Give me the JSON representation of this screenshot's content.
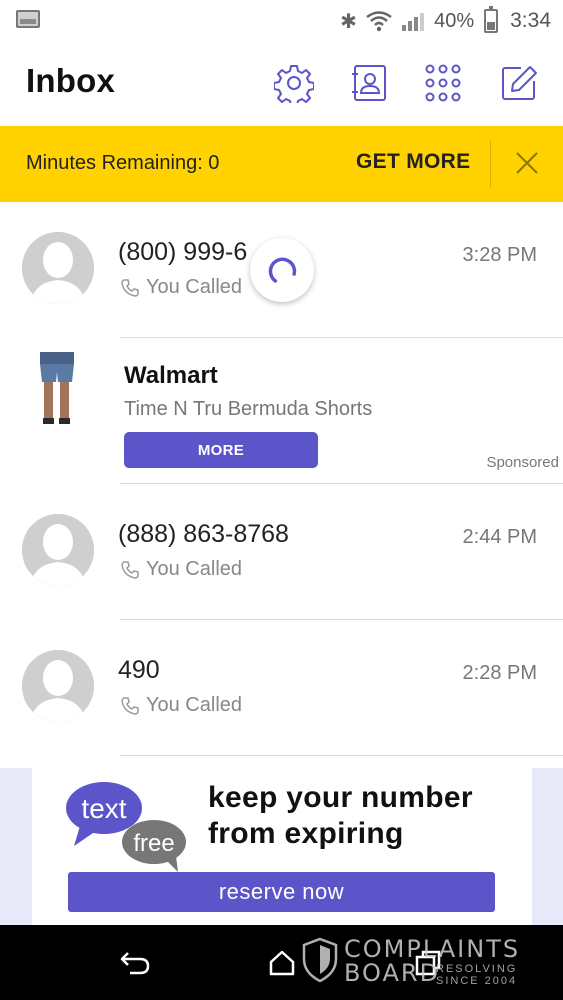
{
  "status_bar": {
    "battery": "40%",
    "time": "3:34"
  },
  "header": {
    "title": "Inbox",
    "icons": [
      "gear-icon",
      "contacts-icon",
      "dialpad-icon",
      "compose-icon"
    ]
  },
  "banner": {
    "text": "Minutes Remaining: 0",
    "action": "GET MORE",
    "color": "#ffd200"
  },
  "conversations": [
    {
      "name": "(800) 999-6",
      "status": "You Called",
      "time": "3:28 PM"
    },
    {
      "name": "(888) 863-8768",
      "status": "You Called",
      "time": "2:44 PM"
    },
    {
      "name": "490",
      "status": "You Called",
      "time": "2:28 PM"
    }
  ],
  "sponsored_ad": {
    "brand": "Walmart",
    "description": "Time N Tru Bermuda Shorts",
    "button": "MORE",
    "label": "Sponsored"
  },
  "bottom_ad": {
    "logo_line1": "text",
    "logo_line2": "free",
    "headline_line1": "keep your number",
    "headline_line2": "from expiring",
    "button": "reserve now"
  },
  "watermark": {
    "line1": "COMPLAINTS",
    "line2": "BOARD",
    "tag1": "RESOLVING",
    "tag2": "SINCE 2004"
  },
  "colors": {
    "accent": "#5b55c9",
    "banner": "#ffd200",
    "icon": "#5b55c9"
  }
}
